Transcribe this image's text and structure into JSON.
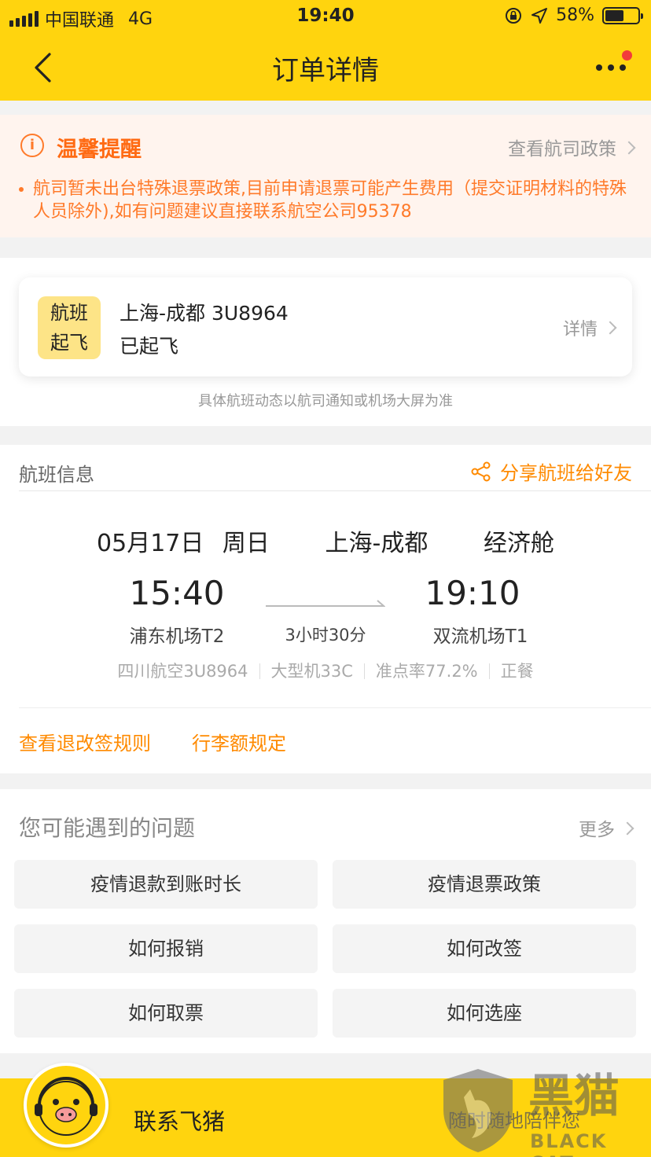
{
  "status_bar": {
    "carrier": "中国联通",
    "network": "4G",
    "time": "19:40",
    "battery": "58%",
    "battery_level": 0.58
  },
  "header": {
    "title": "订单详情",
    "icons": [
      "back-chevron-icon",
      "more-dots-icon",
      "notification-red-dot"
    ]
  },
  "notice": {
    "title": "温馨提醒",
    "link_label": "查看航司政策",
    "body": "航司暂未出台特殊退票政策,目前申请退票可能产生费用（提交证明材料的特殊人员除外),如有问题建议直接联系航空公司95378",
    "accent_color": "#ff7a2a"
  },
  "flight_status": {
    "badge_line1": "航班",
    "badge_line2": "起飞",
    "route": "上海-成都 3U8964",
    "state": "已起飞",
    "detail_label": "详情",
    "note": "具体航班动态以航司通知或机场大屏为准"
  },
  "flight_info": {
    "section_title": "航班信息",
    "share_label": "分享航班给好友",
    "date": "05月17日",
    "weekday": "周日",
    "route": "上海-成都",
    "cabin": "经济舱",
    "dep_time": "15:40",
    "arr_time": "19:10",
    "dep_airport": "浦东机场T2",
    "arr_airport": "双流机场T1",
    "duration": "3小时30分",
    "airline": "四川航空3U8964",
    "aircraft": "大型机33C",
    "on_time": "准点率77.2%",
    "meal": "正餐",
    "rules_label": "查看退改签规则",
    "baggage_label": "行李额规定"
  },
  "faq": {
    "title": "您可能遇到的问题",
    "more_label": "更多",
    "items": [
      "疫情退款到账时长",
      "疫情退票政策",
      "如何报销",
      "如何改签",
      "如何取票",
      "如何选座"
    ]
  },
  "bottom": {
    "contact_label": "联系飞猪",
    "subtext": "随时随地陪伴您",
    "watermark_cn": "黑猫",
    "watermark_en": "BLACK CAT",
    "brand_color": "#ffd40e"
  }
}
